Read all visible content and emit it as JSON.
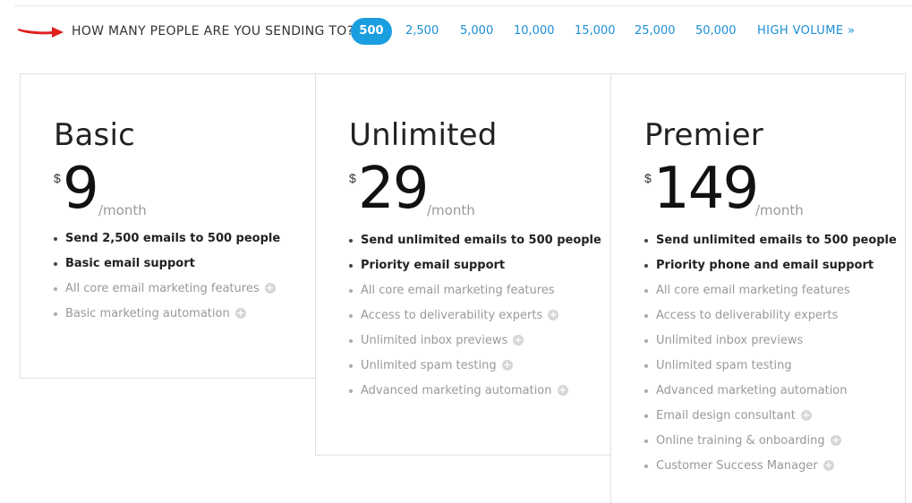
{
  "header": {
    "question": "HOW MANY PEOPLE ARE YOU SENDING TO?",
    "selected": "500",
    "options": [
      "2,500",
      "5,000",
      "10,000",
      "15,000",
      "25,000",
      "50,000"
    ],
    "high_volume": "HIGH VOLUME »"
  },
  "colors": {
    "accent": "#1b9ee0",
    "link": "#1b8fd8",
    "arrow": "#e02020"
  },
  "icons": {
    "arrow": "red-arrow-icon",
    "plus": "plus-circle-icon"
  },
  "plans": [
    {
      "name": "Basic",
      "currency": "$",
      "price": "9",
      "period": "/month",
      "features": [
        {
          "text": "Send 2,500 emails to 500 people",
          "strong": true,
          "info": false
        },
        {
          "text": "Basic email support",
          "strong": true,
          "info": false
        },
        {
          "text": "All core email marketing features",
          "strong": false,
          "info": true
        },
        {
          "text": "Basic marketing automation",
          "strong": false,
          "info": true
        }
      ]
    },
    {
      "name": "Unlimited",
      "currency": "$",
      "price": "29",
      "period": "/month",
      "features": [
        {
          "text": "Send unlimited emails to 500 people",
          "strong": true,
          "info": false
        },
        {
          "text": "Priority email support",
          "strong": true,
          "info": false
        },
        {
          "text": "All core email marketing features",
          "strong": false,
          "info": false
        },
        {
          "text": "Access to deliverability experts",
          "strong": false,
          "info": true
        },
        {
          "text": "Unlimited inbox previews",
          "strong": false,
          "info": true
        },
        {
          "text": "Unlimited spam testing",
          "strong": false,
          "info": true
        },
        {
          "text": "Advanced marketing automation",
          "strong": false,
          "info": true
        }
      ]
    },
    {
      "name": "Premier",
      "currency": "$",
      "price": "149",
      "period": "/month",
      "features": [
        {
          "text": "Send unlimited emails to 500 people",
          "strong": true,
          "info": false
        },
        {
          "text": "Priority phone and email support",
          "strong": true,
          "info": false
        },
        {
          "text": "All core email marketing features",
          "strong": false,
          "info": false
        },
        {
          "text": "Access to deliverability experts",
          "strong": false,
          "info": false
        },
        {
          "text": "Unlimited inbox previews",
          "strong": false,
          "info": false
        },
        {
          "text": "Unlimited spam testing",
          "strong": false,
          "info": false
        },
        {
          "text": "Advanced marketing automation",
          "strong": false,
          "info": false
        },
        {
          "text": "Email design consultant",
          "strong": false,
          "info": true
        },
        {
          "text": "Online training & onboarding",
          "strong": false,
          "info": true
        },
        {
          "text": "Customer Success Manager",
          "strong": false,
          "info": true
        }
      ]
    }
  ]
}
